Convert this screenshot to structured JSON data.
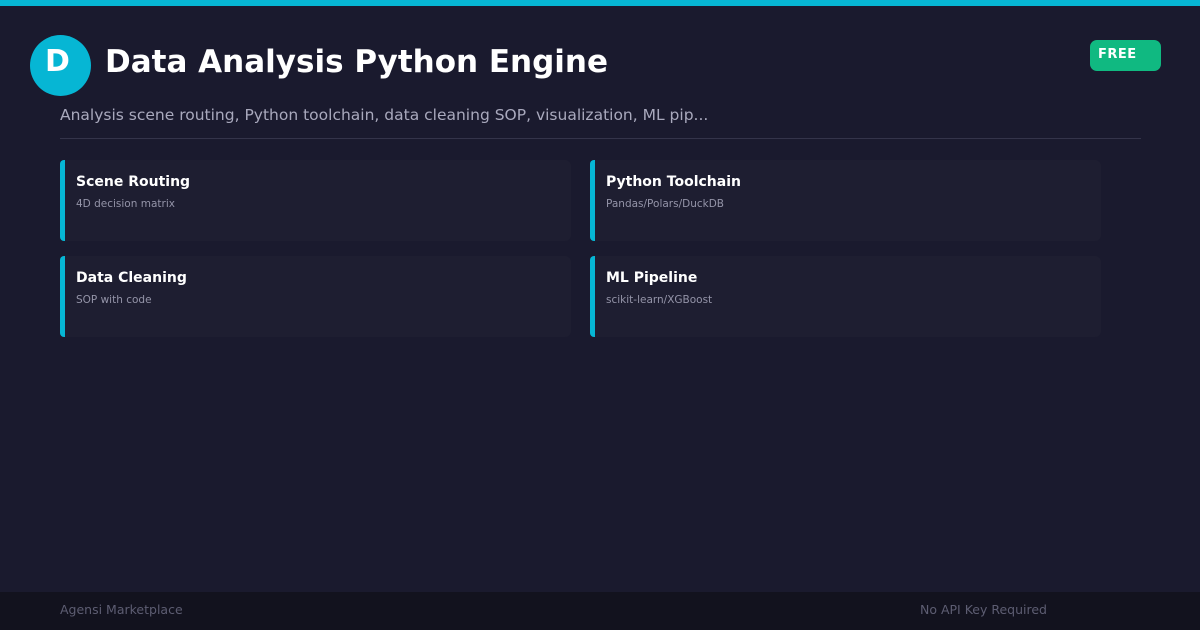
{
  "colors": {
    "accent": "#06b6d4",
    "badge": "#10b981",
    "background": "#1a1a2e",
    "card": "#1e1e31",
    "footer": "#12121e"
  },
  "header": {
    "avatar_letter": "D",
    "title": "Data Analysis Python Engine",
    "badge": "FREE"
  },
  "subtitle": "Analysis scene routing, Python toolchain, data cleaning SOP, visualization, ML pip...",
  "features": [
    {
      "title": "Scene Routing",
      "description": "4D decision matrix"
    },
    {
      "title": "Python Toolchain",
      "description": "Pandas/Polars/DuckDB"
    },
    {
      "title": "Data Cleaning",
      "description": "SOP with code"
    },
    {
      "title": "ML Pipeline",
      "description": "scikit-learn/XGBoost"
    }
  ],
  "footer": {
    "left": "Agensi Marketplace",
    "right": "No API Key Required"
  }
}
